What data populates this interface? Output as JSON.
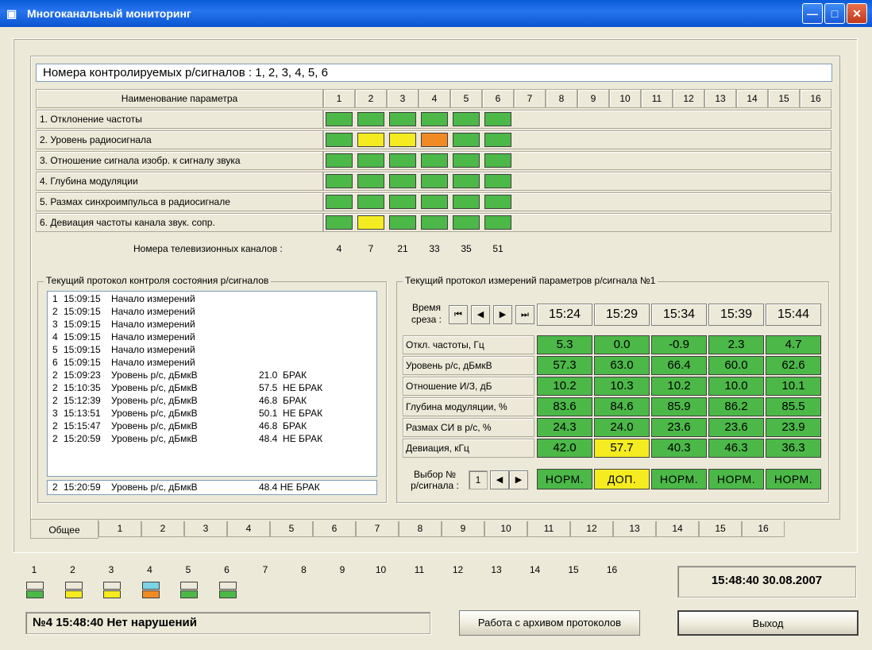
{
  "window": {
    "title": "Многоканальный мониторинг",
    "icon": "monitor-app-icon"
  },
  "header_line": "Номера контролируемых р/сигналов : 1, 2, 3, 4, 5, 6",
  "grid": {
    "param_header": "Наименование параметра",
    "columns": [
      "1",
      "2",
      "3",
      "4",
      "5",
      "6",
      "7",
      "8",
      "9",
      "10",
      "11",
      "12",
      "13",
      "14",
      "15",
      "16"
    ],
    "params": [
      "1. Отклонение частоты",
      "2. Уровень радиосигнала",
      "3. Отношение сигнала изобр. к сигналу звука",
      "4. Глубина модуляции",
      "5. Размах синхроимпульса в радиосигнале",
      "6. Девиация частоты канала звук. сопр."
    ],
    "states": [
      [
        "g",
        "g",
        "g",
        "g",
        "g",
        "g"
      ],
      [
        "g",
        "y",
        "y",
        "o",
        "g",
        "g"
      ],
      [
        "g",
        "g",
        "g",
        "g",
        "g",
        "g"
      ],
      [
        "g",
        "g",
        "g",
        "g",
        "g",
        "g"
      ],
      [
        "g",
        "g",
        "g",
        "g",
        "g",
        "g"
      ],
      [
        "g",
        "y",
        "g",
        "g",
        "g",
        "g"
      ]
    ],
    "colors": {
      "g": "#4CB848",
      "y": "#F4EC20",
      "o": "#F08B24"
    },
    "tv_label": "Номера телевизионных каналов :",
    "tv_channels": [
      "4",
      "7",
      "21",
      "33",
      "35",
      "51"
    ]
  },
  "log": {
    "title": "Текущий протокол контроля состояния р/сигналов",
    "rows": [
      [
        "1",
        "15:09:15",
        "Начало измерений",
        ""
      ],
      [
        "2",
        "15:09:15",
        "Начало измерений",
        ""
      ],
      [
        "3",
        "15:09:15",
        "Начало измерений",
        ""
      ],
      [
        "4",
        "15:09:15",
        "Начало измерений",
        ""
      ],
      [
        "5",
        "15:09:15",
        "Начало измерений",
        ""
      ],
      [
        "6",
        "15:09:15",
        "Начало измерений",
        ""
      ],
      [
        "2",
        "15:09:23",
        "Уровень р/с, дБмкВ",
        "21.0  БРАК"
      ],
      [
        "2",
        "15:10:35",
        "Уровень р/с, дБмкВ",
        "57.5  НЕ БРАК"
      ],
      [
        "2",
        "15:12:39",
        "Уровень р/с, дБмкВ",
        "46.8  БРАК"
      ],
      [
        "3",
        "15:13:51",
        "Уровень р/с, дБмкВ",
        "50.1  НЕ БРАК"
      ],
      [
        "2",
        "15:15:47",
        "Уровень р/с, дБмкВ",
        "46.8  БРАК"
      ],
      [
        "2",
        "15:20:59",
        "Уровень р/с, дБмкВ",
        "48.4  НЕ БРАК"
      ]
    ],
    "last": [
      "2",
      "15:20:59",
      "Уровень р/с, дБмкВ",
      "48.4  НЕ БРАК"
    ]
  },
  "measure": {
    "title": "Текущий протокол измерений параметров р/сигнала №1",
    "time_label": "Время\nсреза :",
    "nav": [
      "⏮",
      "◀",
      "▶",
      "⏭"
    ],
    "times": [
      "15:24",
      "15:29",
      "15:34",
      "15:39",
      "15:44"
    ],
    "params": [
      {
        "label": "Откл. частоты,  Гц",
        "values": [
          "5.3",
          "0.0",
          "-0.9",
          "2.3",
          "4.7"
        ],
        "colors": [
          "g",
          "g",
          "g",
          "g",
          "g"
        ]
      },
      {
        "label": "Уровень р/с,  дБмкВ",
        "values": [
          "57.3",
          "63.0",
          "66.4",
          "60.0",
          "62.6"
        ],
        "colors": [
          "g",
          "g",
          "g",
          "g",
          "g"
        ]
      },
      {
        "label": "Отношение И/З,  дБ",
        "values": [
          "10.2",
          "10.3",
          "10.2",
          "10.0",
          "10.1"
        ],
        "colors": [
          "g",
          "g",
          "g",
          "g",
          "g"
        ]
      },
      {
        "label": "Глубина модуляции,  %",
        "values": [
          "83.6",
          "84.6",
          "85.9",
          "86.2",
          "85.5"
        ],
        "colors": [
          "g",
          "g",
          "g",
          "g",
          "g"
        ]
      },
      {
        "label": "Размах СИ в р/с,  %",
        "values": [
          "24.3",
          "24.0",
          "23.6",
          "23.6",
          "23.9"
        ],
        "colors": [
          "g",
          "g",
          "g",
          "g",
          "g"
        ]
      },
      {
        "label": "Девиация,  кГц",
        "values": [
          "42.0",
          "57.7",
          "40.3",
          "46.3",
          "36.3"
        ],
        "colors": [
          "g",
          "y",
          "g",
          "g",
          "g"
        ]
      }
    ],
    "select_label": "Выбор №\nр/сигнала :",
    "select_value": "1",
    "status": [
      "НОРМ.",
      "ДОП.",
      "НОРМ.",
      "НОРМ.",
      "НОРМ."
    ],
    "status_colors": [
      "g",
      "y",
      "g",
      "g",
      "g"
    ]
  },
  "tabs": [
    "Общее",
    "1",
    "2",
    "3",
    "4",
    "5",
    "6",
    "7",
    "8",
    "9",
    "10",
    "11",
    "12",
    "13",
    "14",
    "15",
    "16"
  ],
  "bottom": {
    "channels": [
      "1",
      "2",
      "3",
      "4",
      "5",
      "6",
      "7",
      "8",
      "9",
      "10",
      "11",
      "12",
      "13",
      "14",
      "15",
      "16"
    ],
    "indicators": [
      [
        "w",
        "g"
      ],
      [
        "w",
        "y"
      ],
      [
        "w",
        "y"
      ],
      [
        "c",
        "o"
      ],
      [
        "w",
        "g"
      ],
      [
        "w",
        "g"
      ]
    ],
    "status_text": "№4  15:48:40  Нет нарушений",
    "archive_button": "Работа с архивом протоколов",
    "clock": "15:48:40   30.08.2007",
    "exit_button": "Выход"
  }
}
